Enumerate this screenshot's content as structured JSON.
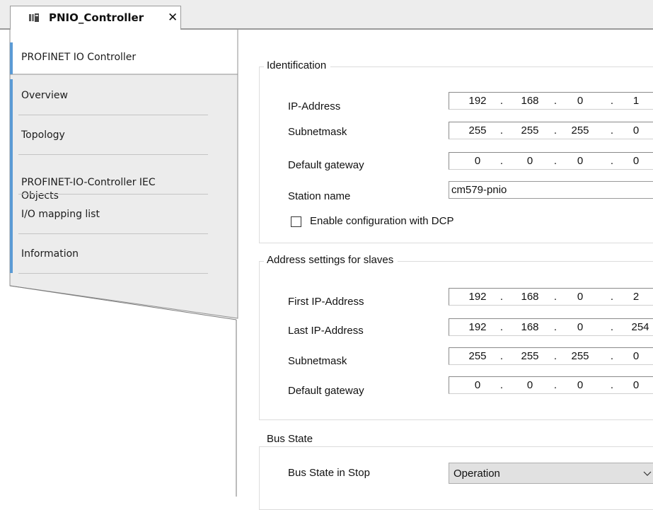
{
  "tab": {
    "title": "PNIO_Controller",
    "close": "✕",
    "icon": "device-module-icon"
  },
  "nav": {
    "items": [
      {
        "label": "PROFINET IO Controller"
      },
      {
        "label": "Overview"
      },
      {
        "label": "Topology"
      },
      {
        "label": "PROFINET-IO-Controller IEC\nObjects"
      },
      {
        "label": "I/O mapping list"
      },
      {
        "label": "Information"
      }
    ],
    "accent_color": "#5b9bd5"
  },
  "identification": {
    "title": "Identification",
    "ip_address": {
      "label": "IP-Address",
      "octets": [
        "192",
        "168",
        "0",
        "1"
      ]
    },
    "subnetmask": {
      "label": "Subnetmask",
      "octets": [
        "255",
        "255",
        "255",
        "0"
      ]
    },
    "default_gateway": {
      "label": "Default gateway",
      "octets": [
        "0",
        "0",
        "0",
        "0"
      ]
    },
    "station_name": {
      "label": "Station name",
      "value": "cm579-pnio"
    },
    "dcp": {
      "label": "Enable configuration with DCP",
      "checked": false
    }
  },
  "slaves": {
    "title": "Address settings for slaves",
    "first_ip": {
      "label": "First IP-Address",
      "octets": [
        "192",
        "168",
        "0",
        "2"
      ]
    },
    "last_ip": {
      "label": "Last IP-Address",
      "octets": [
        "192",
        "168",
        "0",
        "254"
      ]
    },
    "subnetmask": {
      "label": "Subnetmask",
      "octets": [
        "255",
        "255",
        "255",
        "0"
      ]
    },
    "default_gateway": {
      "label": "Default gateway",
      "octets": [
        "0",
        "0",
        "0",
        "0"
      ]
    }
  },
  "bus_state": {
    "title": "Bus State",
    "stop": {
      "label": "Bus State in Stop",
      "value": "Operation"
    }
  },
  "ip_separator": "."
}
